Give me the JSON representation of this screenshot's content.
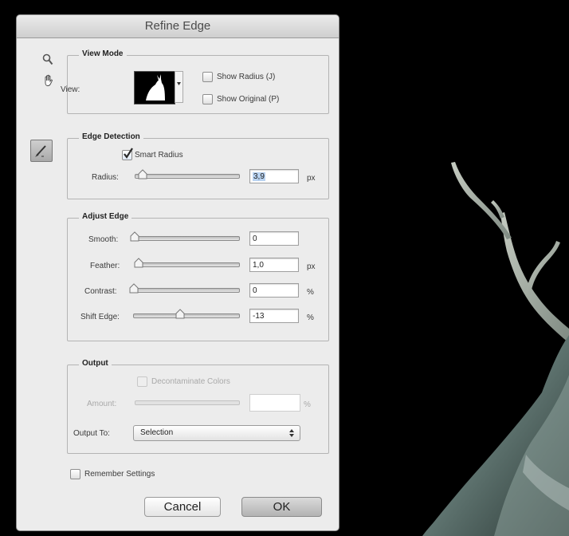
{
  "dialog": {
    "title": "Refine Edge"
  },
  "view_mode": {
    "heading": "View Mode",
    "view_label": "View:",
    "show_radius_label": "Show Radius (J)",
    "show_original_label": "Show Original (P)"
  },
  "edge_detection": {
    "heading": "Edge Detection",
    "smart_radius_label": "Smart Radius",
    "smart_radius_checked": true,
    "radius_label": "Radius:",
    "radius_value": "3,9",
    "radius_unit": "px"
  },
  "adjust_edge": {
    "heading": "Adjust Edge",
    "smooth_label": "Smooth:",
    "smooth_value": "0",
    "feather_label": "Feather:",
    "feather_value": "1,0",
    "feather_unit": "px",
    "contrast_label": "Contrast:",
    "contrast_value": "0",
    "contrast_unit": "%",
    "shift_edge_label": "Shift Edge:",
    "shift_edge_value": "-13",
    "shift_edge_unit": "%"
  },
  "output": {
    "heading": "Output",
    "decontaminate_label": "Decontaminate Colors",
    "amount_label": "Amount:",
    "amount_unit": "%",
    "output_to_label": "Output To:",
    "output_to_value": "Selection"
  },
  "remember_settings_label": "Remember Settings",
  "buttons": {
    "cancel": "Cancel",
    "ok": "OK"
  },
  "colors": {
    "canvas": "#000000",
    "dialog_bg": "#ececec",
    "deer_fur": "#6e8480"
  }
}
